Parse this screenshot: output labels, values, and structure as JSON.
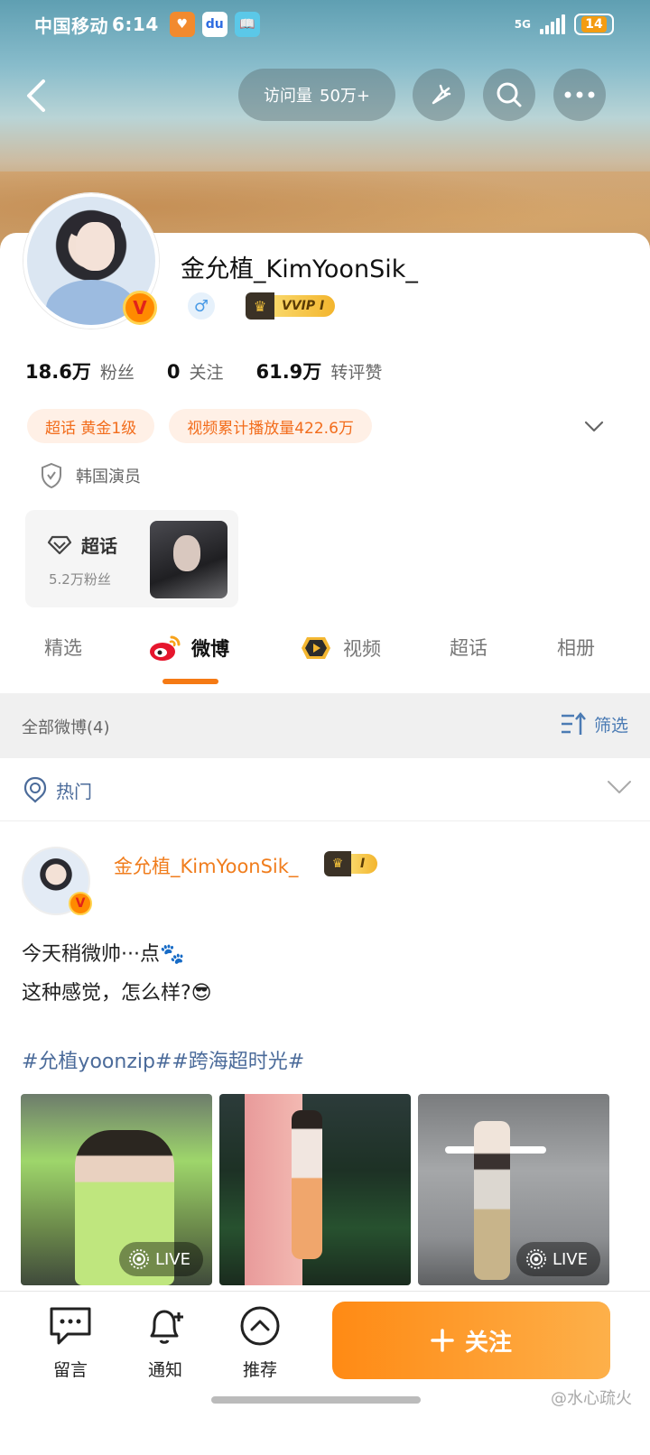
{
  "status_bar": {
    "carrier": "中国移动",
    "time": "6:14",
    "network": "5G",
    "battery": "14"
  },
  "header": {
    "visits_label": "访问量",
    "visits_value": "50万+"
  },
  "profile": {
    "name": "金允植_KimYoonSik_",
    "vip_label": "VVIP Ⅰ",
    "stats": [
      {
        "value": "18.6万",
        "label": "粉丝"
      },
      {
        "value": "0",
        "label": "关注"
      },
      {
        "value": "61.9万",
        "label": "转评赞"
      }
    ],
    "chips": [
      "超话 黄金1级",
      "视频累计播放量422.6万"
    ],
    "identity": "韩国演员",
    "supertopic": {
      "title": "超话",
      "fans": "5.2万粉丝"
    }
  },
  "tabs": [
    {
      "label": "精选"
    },
    {
      "label": "微博"
    },
    {
      "label": "视频"
    },
    {
      "label": "超话"
    },
    {
      "label": "相册"
    }
  ],
  "feed": {
    "all_label": "全部微博(4)",
    "filter_label": "筛选",
    "hot_label": "热门"
  },
  "post": {
    "author": "金允植_KimYoonSik_",
    "vip_label": "Ⅰ",
    "line1": "今天稍微帅···点🐾",
    "line2": "这种感觉，怎么样?😎",
    "hashtags": "#允植yoonzip##跨海超时光#",
    "live_label": "LIVE"
  },
  "bottom_bar": {
    "comment": "留言",
    "notify": "通知",
    "recommend": "推荐",
    "follow": "关注"
  },
  "watermark": "@水心疏火",
  "colors": {
    "accent": "#f57a14",
    "link": "#4b6b9a"
  }
}
